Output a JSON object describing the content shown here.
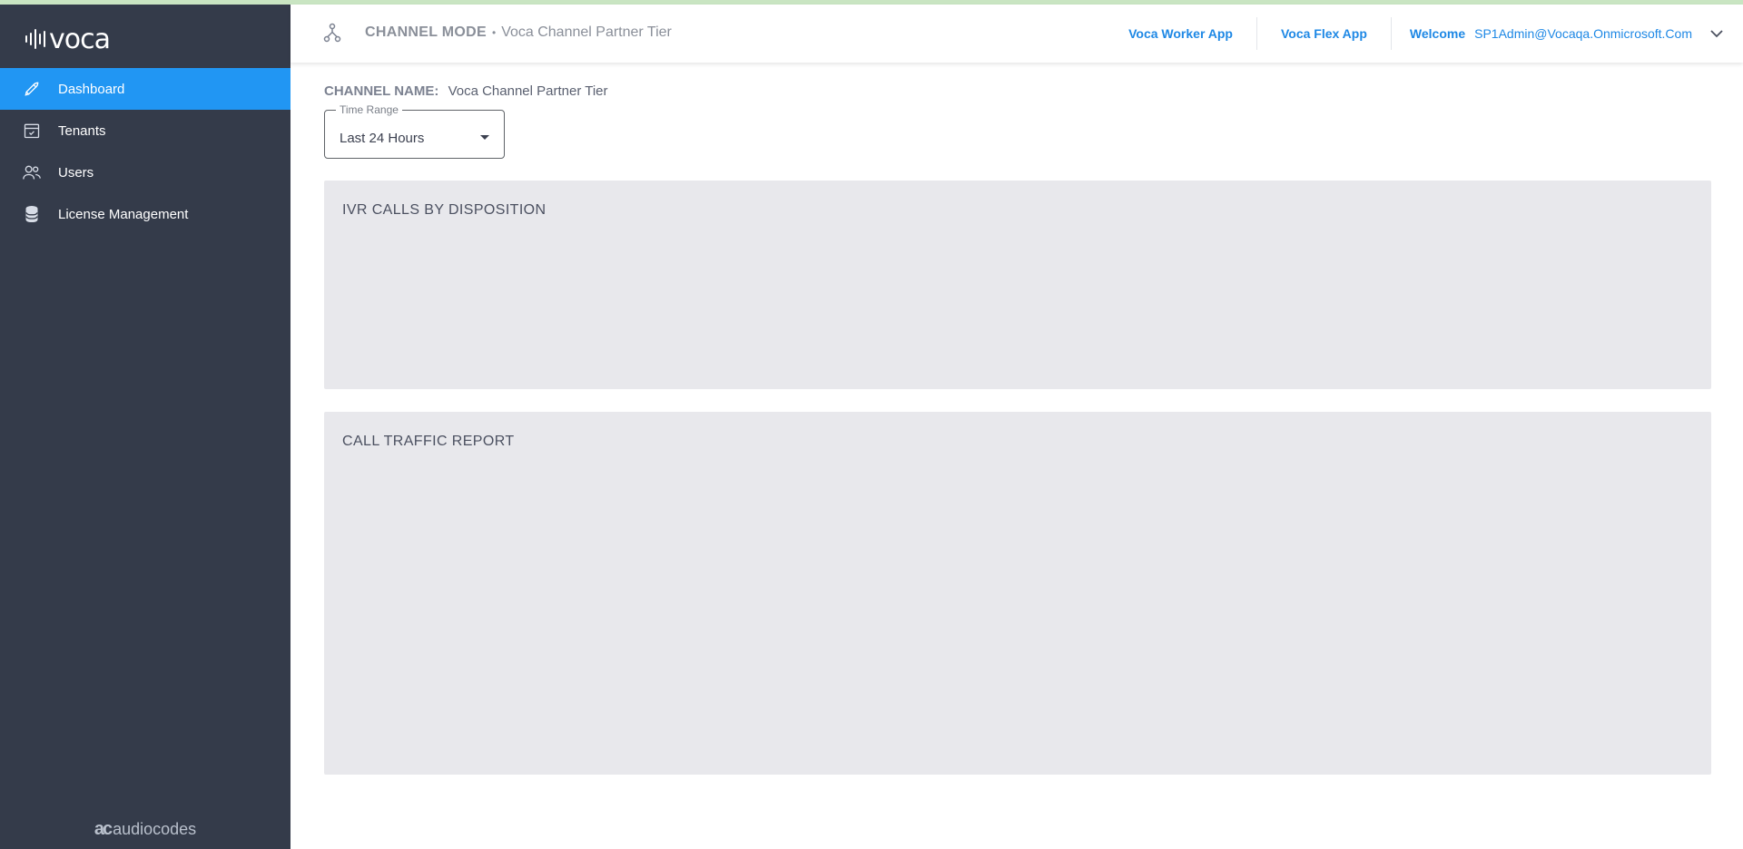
{
  "app": {
    "logo_text": "voca",
    "footer_brand": "audiocodes",
    "accent_color": "#2196f3",
    "sidebar_color": "#343b4a"
  },
  "sidebar": {
    "items": [
      {
        "label": "Dashboard",
        "icon": "rocket-icon",
        "active": true
      },
      {
        "label": "Tenants",
        "icon": "calendar-check-icon",
        "active": false
      },
      {
        "label": "Users",
        "icon": "users-icon",
        "active": false
      },
      {
        "label": "License Management",
        "icon": "database-icon",
        "active": false
      }
    ]
  },
  "header": {
    "mode_label": "CHANNEL MODE",
    "mode_separator": "•",
    "mode_value": "Voca Channel Partner Tier",
    "links": [
      "Voca Worker App",
      "Voca Flex App"
    ],
    "welcome_label": "Welcome",
    "user_email": "SP1Admin@Vocaqa.Onmicrosoft.Com"
  },
  "main": {
    "channel_name_label": "CHANNEL NAME:",
    "channel_name_value": "Voca Channel Partner Tier",
    "time_range": {
      "label": "Time Range",
      "value": "Last 24 Hours"
    },
    "panels": [
      {
        "title": "IVR CALLS BY DISPOSITION"
      },
      {
        "title": "CALL TRAFFIC REPORT"
      }
    ]
  }
}
